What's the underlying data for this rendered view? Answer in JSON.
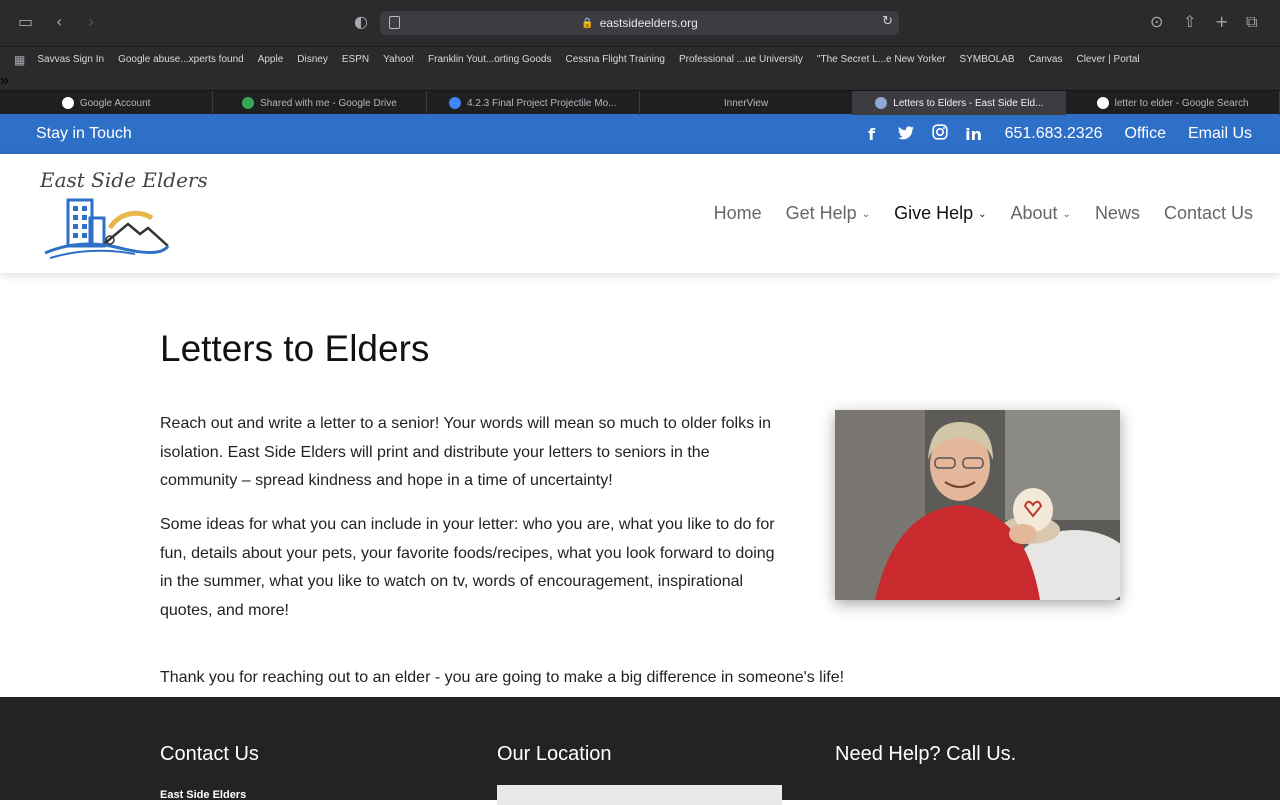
{
  "browser": {
    "url": "eastsideelders.org",
    "bookmarks": [
      "Savvas Sign In",
      "Google abuse...xperts found",
      "Apple",
      "Disney",
      "ESPN",
      "Yahoo!",
      "Franklin Yout...orting Goods",
      "Cessna Flight Training",
      "Professional ...ue University",
      "\"The Secret L...e New Yorker",
      "SYMBOLAB",
      "Canvas",
      "Clever | Portal"
    ],
    "tabs": [
      {
        "label": "Google Account",
        "icon": "google-icon",
        "color": "#ffffff"
      },
      {
        "label": "Shared with me - Google Drive",
        "icon": "google-drive-icon",
        "color": "#34a853"
      },
      {
        "label": "4.2.3 Final Project Projectile Mo...",
        "icon": "google-docs-icon",
        "color": "#4285f4"
      },
      {
        "label": "InnerView",
        "icon": "",
        "color": ""
      },
      {
        "label": "Letters to Elders - East Side Eld...",
        "icon": "site-favicon-icon",
        "color": "#8fa9d6"
      },
      {
        "label": "letter to elder - Google Search",
        "icon": "google-icon",
        "color": "#ffffff"
      }
    ]
  },
  "topbar": {
    "stay": "Stay in Touch",
    "phone": "651.683.2326",
    "office": "Office",
    "email": "Email Us",
    "social": {
      "facebook": "f",
      "twitter": "t",
      "instagram": "◎",
      "linkedin": "in"
    }
  },
  "logo": {
    "text": "East Side Elders"
  },
  "nav": {
    "home": "Home",
    "get_help": "Get Help",
    "give_help": "Give Help",
    "about": "About",
    "news": "News",
    "contact": "Contact Us"
  },
  "content": {
    "title": "Letters to Elders",
    "p1": "Reach out and write a letter to a senior!  Your words will mean so much to older folks in isolation.  East Side Elders will print and distribute your letters to seniors in the community – spread kindness and hope in a time of uncertainty!",
    "p2": "Some ideas for what you can include in your letter:  who you are, what you like to do for fun, details about your pets, your favorite foods/recipes, what you look forward to doing in the summer, what you like to watch on tv, words of encouragement, inspirational quotes, and more!",
    "p3": "Thank you for reaching out to an elder - you are going to make a big difference in someone's life!"
  },
  "footer": {
    "contact_heading": "Contact Us",
    "location_heading": "Our Location",
    "help_heading": "Need Help?  Call Us.",
    "org_name": "East Side Elders"
  },
  "colors": {
    "brand_blue": "#2e6fc7",
    "footer_bg": "#232323"
  }
}
